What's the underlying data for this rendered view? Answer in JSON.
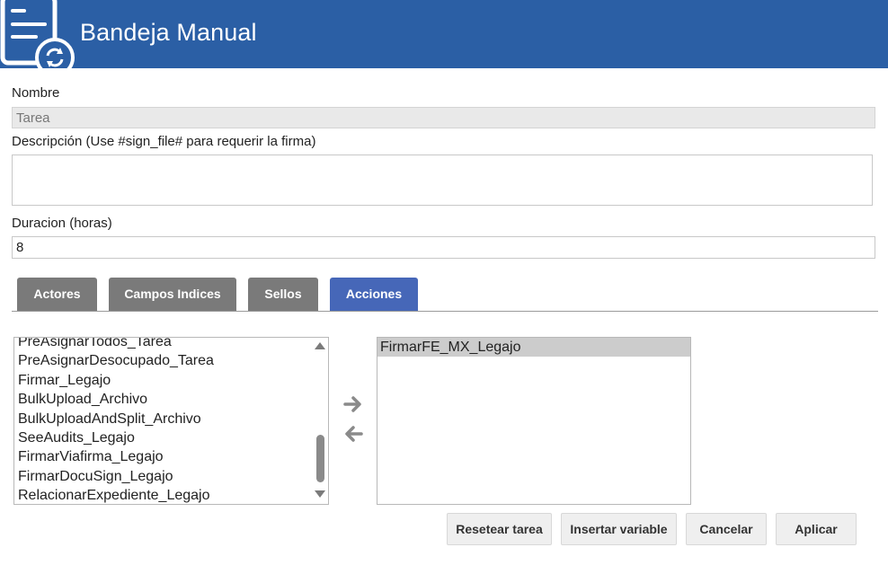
{
  "header": {
    "title": "Bandeja Manual",
    "icon": "document-sync-icon",
    "bg_color": "#2b5fa5"
  },
  "form": {
    "nombre_label": "Nombre",
    "nombre_value": "Tarea",
    "descripcion_label": "Descripción (Use #sign_file# para requerir la firma)",
    "descripcion_value": "",
    "duracion_label": "Duracion (horas)",
    "duracion_value": "8"
  },
  "tabs": [
    {
      "label": "Actores",
      "active": false
    },
    {
      "label": "Campos Indices",
      "active": false
    },
    {
      "label": "Sellos",
      "active": false
    },
    {
      "label": "Acciones",
      "active": true
    }
  ],
  "available_actions": [
    "PreAsignarTodos_Tarea",
    "PreAsignarDesocupado_Tarea",
    "Firmar_Legajo",
    "BulkUpload_Archivo",
    "BulkUploadAndSplit_Archivo",
    "SeeAudits_Legajo",
    "FirmarViafirma_Legajo",
    "FirmarDocuSign_Legajo",
    "RelacionarExpediente_Legajo"
  ],
  "selected_actions": [
    "FirmarFE_MX_Legajo"
  ],
  "transfer": {
    "add_icon": "arrow-right-icon",
    "remove_icon": "arrow-left-icon"
  },
  "buttons": {
    "reset": "Resetear tarea",
    "insert_variable": "Insertar variable",
    "cancel": "Cancelar",
    "apply": "Aplicar"
  },
  "colors": {
    "tab_inactive": "#7a7a7a",
    "tab_active": "#4667b8"
  }
}
